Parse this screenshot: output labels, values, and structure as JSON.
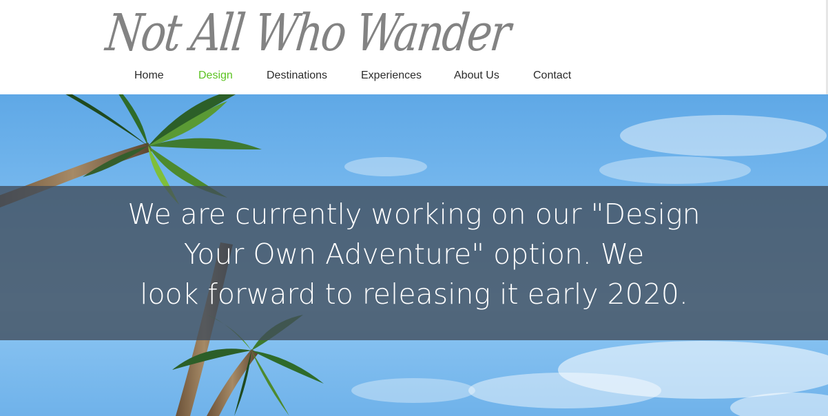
{
  "site": {
    "logo_text": "Not All Who Wander"
  },
  "nav": {
    "items": [
      {
        "label": "Home"
      },
      {
        "label": "Design",
        "active": true
      },
      {
        "label": "Destinations"
      },
      {
        "label": "Experiences"
      },
      {
        "label": "About Us"
      },
      {
        "label": "Contact"
      }
    ],
    "active_color": "#5cc322"
  },
  "hero": {
    "message_lines": [
      "We are currently working on our  \"Design",
      "Your Own Adventure\" option. We",
      "look forward to releasing it early 2020."
    ]
  }
}
